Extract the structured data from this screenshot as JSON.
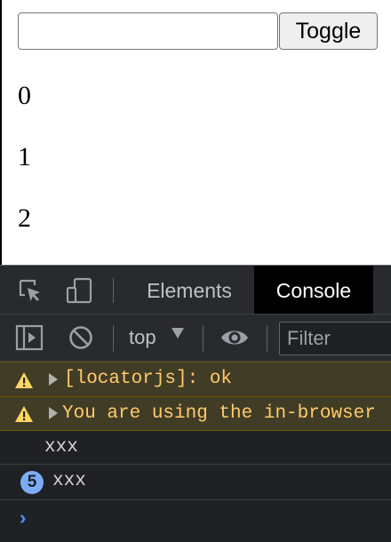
{
  "page": {
    "input": {
      "value": "",
      "placeholder": ""
    },
    "toggle_label": "Toggle",
    "items": [
      "0",
      "1",
      "2"
    ]
  },
  "devtools": {
    "tabs": {
      "elements": "Elements",
      "console": "Console"
    },
    "toolbar": {
      "context": "top",
      "filter_placeholder": "Filter"
    },
    "messages": [
      {
        "level": "warning",
        "text": "[locatorjs]: ok"
      },
      {
        "level": "warning",
        "text": "You are using the in-browser"
      },
      {
        "level": "log",
        "text": "xxx",
        "count": ""
      },
      {
        "level": "log",
        "text": "xxx",
        "count": "5"
      }
    ],
    "prompt": "›",
    "colors": {
      "panel_bg": "#202124",
      "toolbar_bg": "#292a2d",
      "warning_bg": "#413c26",
      "warning_text": "#ffcb6b",
      "badge": "#7cacf8",
      "prompt": "#4d90fe"
    }
  },
  "icons": {
    "inspect": "inspect-element-icon",
    "device": "device-toolbar-icon",
    "sidebar": "console-sidebar-icon",
    "clear": "clear-console-icon",
    "live": "live-expression-eye-icon",
    "warning": "warning-icon"
  }
}
